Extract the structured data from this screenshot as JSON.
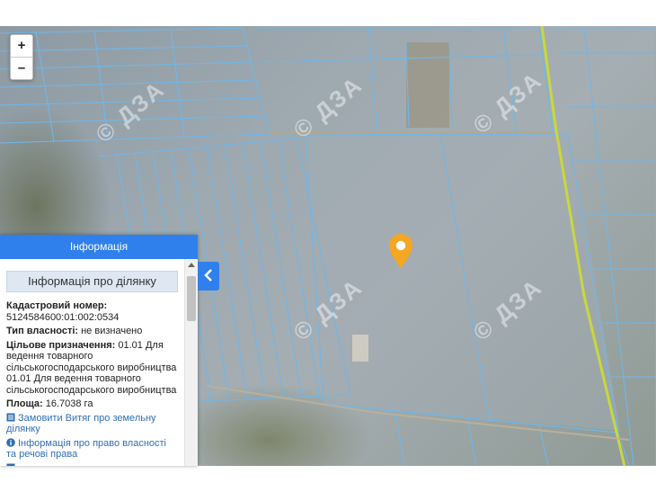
{
  "zoom": {
    "in_label": "+",
    "out_label": "–"
  },
  "watermark": "© ДЗА",
  "panel": {
    "header": "Інформація",
    "section_title": "Інформація про ділянку",
    "cadastral_label": "Кадастровий номер:",
    "cadastral_value": "5124584600:01:002:0534",
    "ownership_label": "Тип власності:",
    "ownership_value": " не визначено",
    "purpose_label": "Цільове призначення:",
    "purpose_value": " 01.01 Для ведення товарного сільськогосподарського виробництва 01.01 Для ведення товарного сільськогосподарського виробництва",
    "area_label": "Площа:",
    "area_value": " 16.7038 га",
    "link_extract": "Замовити Витяг про земельну ділянку",
    "link_rights": "Інформація про право власності та речові права"
  },
  "collapse_icon": "chevron-left-icon",
  "colors": {
    "accent": "#2f80ed",
    "parcel": "#6fb7ea",
    "marker": "#f5a623",
    "road": "#c8d93a"
  }
}
